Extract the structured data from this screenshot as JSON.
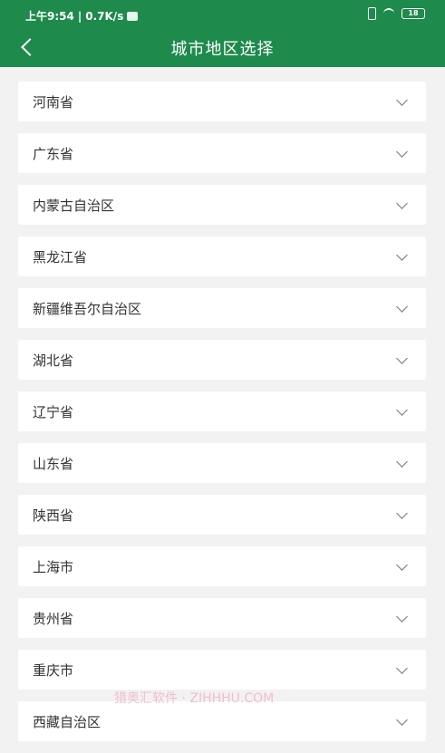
{
  "status": {
    "time": "上午9:54",
    "speed": "0.7K/s",
    "battery": "18"
  },
  "header": {
    "title": "城市地区选择",
    "back_icon": "chevron-left-icon"
  },
  "regions": [
    "河南省",
    "广东省",
    "内蒙古自治区",
    "黑龙江省",
    "新疆维吾尔自治区",
    "湖北省",
    "辽宁省",
    "山东省",
    "陕西省",
    "上海市",
    "贵州省",
    "重庆市",
    "西藏自治区"
  ],
  "watermark": "猎奥汇软件 · ZIHHHU.COM",
  "colors": {
    "header_bg": "#1e8a4c",
    "page_bg": "#f2f2f2"
  }
}
